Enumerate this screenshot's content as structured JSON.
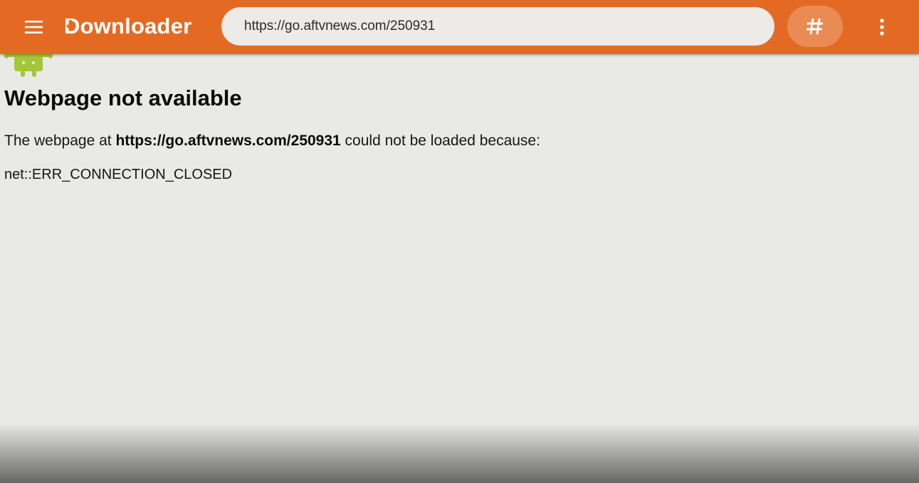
{
  "app": {
    "title": "Downloader"
  },
  "toolbar": {
    "menu_icon": "hamburger-menu-icon",
    "url_value": "https://go.aftvnews.com/250931",
    "hash_label": "#",
    "more_icon": "vertical-dots-icon"
  },
  "error_page": {
    "title": "Webpage not available",
    "message_prefix": "The webpage at ",
    "message_url": "https://go.aftvnews.com/250931",
    "message_suffix": " could not be loaded because:",
    "error_code": "net::ERR_CONNECTION_CLOSED"
  },
  "colors": {
    "toolbar_bg": "#e46a23",
    "hash_button_bg": "#ea8b54",
    "url_bar_bg": "#ecebe7",
    "page_bg": "#e9e9e6",
    "android_green": "#a4c639"
  }
}
